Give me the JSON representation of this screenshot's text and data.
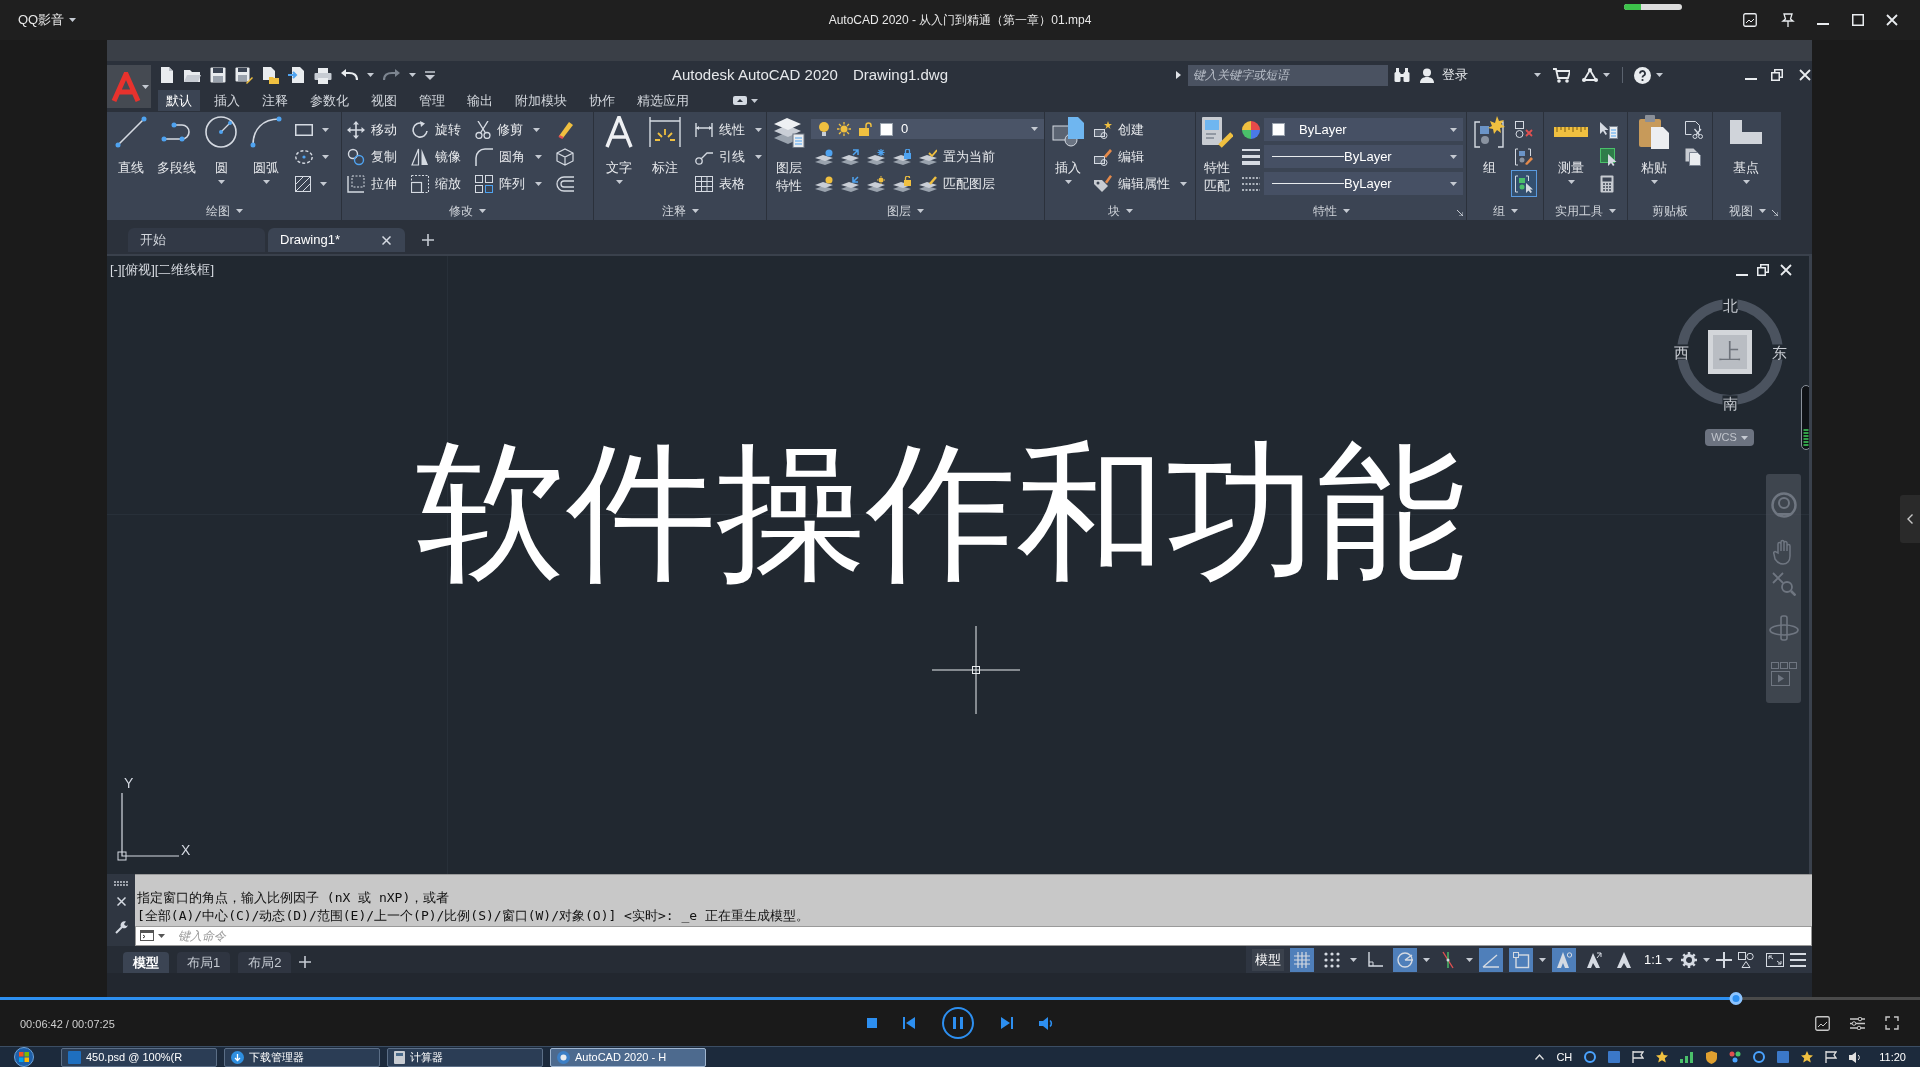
{
  "player_window": {
    "app_name": "QQ影音",
    "title": "AutoCAD 2020 - 从入门到精通（第一章）01.mp4",
    "meter": {
      "level": 0.3
    }
  },
  "autocad": {
    "title": "Autodesk AutoCAD 2020",
    "document_name": "Drawing1.dwg",
    "search": {
      "placeholder": "键入关键字或短语"
    },
    "sign_in": "登录",
    "ribbon_tabs": [
      {
        "label": "默认",
        "selected": true
      },
      {
        "label": "插入",
        "selected": false
      },
      {
        "label": "注释",
        "selected": false
      },
      {
        "label": "参数化",
        "selected": false
      },
      {
        "label": "视图",
        "selected": false
      },
      {
        "label": "管理",
        "selected": false
      },
      {
        "label": "输出",
        "selected": false
      },
      {
        "label": "附加模块",
        "selected": false
      },
      {
        "label": "协作",
        "selected": false
      },
      {
        "label": "精选应用",
        "selected": false
      }
    ],
    "ribbon_panels": [
      {
        "title": "绘图",
        "menu": true,
        "launcher": false,
        "columns": [
          {
            "kind": "large",
            "label": "直线",
            "menu": false
          },
          {
            "kind": "large",
            "label": "多段线",
            "menu": false
          },
          {
            "kind": "large",
            "label": "圆",
            "menu": true
          },
          {
            "kind": "large",
            "label": "圆弧",
            "menu": true
          },
          {
            "kind": "stack",
            "rows": [
              {
                "menu": true
              },
              {
                "menu": true
              },
              {
                "menu": true
              }
            ]
          }
        ]
      },
      {
        "title": "修改",
        "menu": true,
        "launcher": false,
        "columns": [
          {
            "kind": "stack",
            "rows": [
              {
                "label": "移动",
                "menu": false
              },
              {
                "label": "复制",
                "menu": false
              },
              {
                "label": "拉伸",
                "menu": false
              }
            ]
          },
          {
            "kind": "stack",
            "rows": [
              {
                "label": "旋转",
                "menu": false
              },
              {
                "label": "镜像",
                "menu": false
              },
              {
                "label": "缩放",
                "menu": false
              }
            ]
          },
          {
            "kind": "stack",
            "rows": [
              {
                "label": "修剪",
                "menu": true
              },
              {
                "label": "圆角",
                "menu": true
              },
              {
                "label": "阵列",
                "menu": true
              }
            ]
          },
          {
            "kind": "stack",
            "rows": [
              {
                "menu": false
              },
              {
                "menu": false
              },
              {
                "menu": false
              }
            ]
          }
        ]
      },
      {
        "title": "注释",
        "menu": true,
        "launcher": false,
        "columns": [
          {
            "kind": "large",
            "label": "文字",
            "menu": true
          },
          {
            "kind": "large",
            "label": "标注",
            "menu": false
          },
          {
            "kind": "stack",
            "rows": [
              {
                "label": "线性",
                "menu": true
              },
              {
                "label": "引线",
                "menu": true
              },
              {
                "label": "表格",
                "menu": false
              }
            ]
          }
        ]
      },
      {
        "title": "图层",
        "menu": true,
        "launcher": false,
        "columns": [
          {
            "kind": "large",
            "label": "图层特性",
            "menu": false
          },
          {
            "kind": "layers",
            "current": "0",
            "rows": [
              {
                "label": "置为当前"
              },
              {
                "label": "匹配图层"
              }
            ]
          }
        ]
      },
      {
        "title": "块",
        "menu": true,
        "launcher": false,
        "columns": [
          {
            "kind": "large",
            "label": "插入",
            "menu": true
          },
          {
            "kind": "stack",
            "rows": [
              {
                "label": "创建",
                "menu": false
              },
              {
                "label": "编辑",
                "menu": false
              },
              {
                "label": "编辑属性",
                "menu": true
              }
            ]
          }
        ]
      },
      {
        "title": "特性",
        "menu": true,
        "launcher": true,
        "columns": [
          {
            "kind": "large",
            "label": "特性匹配",
            "menu": false
          },
          {
            "kind": "combos",
            "rows": [
              {
                "value": "ByLayer"
              },
              {
                "value": "ByLayer"
              },
              {
                "value": "ByLayer"
              }
            ]
          }
        ]
      },
      {
        "title": "组",
        "menu": true,
        "launcher": false,
        "columns": [
          {
            "kind": "large",
            "label": "组",
            "menu": false
          },
          {
            "kind": "stack",
            "rows": [
              {
                "menu": false,
                "on": false
              },
              {
                "menu": false,
                "on": false
              },
              {
                "menu": false,
                "on": true
              }
            ]
          }
        ]
      },
      {
        "title": "实用工具",
        "menu": true,
        "launcher": false,
        "columns": [
          {
            "kind": "large",
            "label": "测量",
            "menu": true
          },
          {
            "kind": "stack",
            "rows": [
              {
                "menu": false
              },
              {
                "menu": false
              },
              {
                "menu": false
              }
            ]
          }
        ]
      },
      {
        "title": "剪贴板",
        "menu": false,
        "launcher": false,
        "columns": [
          {
            "kind": "large",
            "label": "粘贴",
            "menu": true
          },
          {
            "kind": "stack",
            "rows": [
              {
                "menu": false
              },
              {
                "menu": false
              }
            ]
          }
        ]
      },
      {
        "title": "视图",
        "menu": true,
        "launcher": true,
        "columns": [
          {
            "kind": "large",
            "label": "基点",
            "menu": true
          }
        ]
      }
    ],
    "document_tabs": [
      {
        "label": "开始",
        "selected": false,
        "closable": false
      },
      {
        "label": "Drawing1*",
        "selected": true,
        "closable": true
      }
    ],
    "viewport": {
      "view_label": "[-][俯视][二维线框]",
      "overlay_title": "软件操作和功能",
      "viewcube": {
        "north": "北",
        "east": "东",
        "south": "南",
        "west": "西",
        "face": "上",
        "ucs_menu": "WCS"
      },
      "ucs_axes": {
        "x": "X",
        "y": "Y"
      }
    },
    "command_line": {
      "history": [
        "指定窗口的角点，输入比例因子 (nX 或 nXP)，或者",
        "[全部(A)/中心(C)/动态(D)/范围(E)/上一个(P)/比例(S)/窗口(W)/对象(O)] <实时>: _e 正在重生成模型。"
      ],
      "placeholder": "键入命令"
    },
    "layout_tabs": [
      {
        "label": "模型",
        "selected": true
      },
      {
        "label": "布局1",
        "selected": false
      },
      {
        "label": "布局2",
        "selected": false
      }
    ],
    "status_bar": {
      "space": "模型",
      "items": [
        {
          "kind": "toggle",
          "on": true
        },
        {
          "kind": "toggle",
          "on": false
        },
        {
          "kind": "menu"
        },
        {
          "kind": "toggle",
          "on": false
        },
        {
          "kind": "toggle",
          "on": true
        },
        {
          "kind": "menu"
        },
        {
          "kind": "toggle",
          "on": false
        },
        {
          "kind": "menu"
        },
        {
          "kind": "toggle",
          "on": true
        },
        {
          "kind": "toggle",
          "on": true
        },
        {
          "kind": "menu"
        },
        {
          "kind": "toggle",
          "on": true
        },
        {
          "kind": "toggle",
          "on": false
        },
        {
          "kind": "toggle",
          "on": false
        }
      ],
      "annotation_scale": "1:1"
    }
  },
  "player_controls": {
    "progress": {
      "level": 0.904
    },
    "time": "00:06:42 / 00:07:25"
  },
  "taskbar": {
    "items": [
      {
        "label": "450.psd @ 100%(R",
        "selected": false
      },
      {
        "label": "下载管理器",
        "selected": false
      },
      {
        "label": "计算器",
        "selected": false
      },
      {
        "label": "AutoCAD 2020 - H",
        "selected": true
      }
    ],
    "input_indicator": "CH",
    "clock": "11:20"
  }
}
